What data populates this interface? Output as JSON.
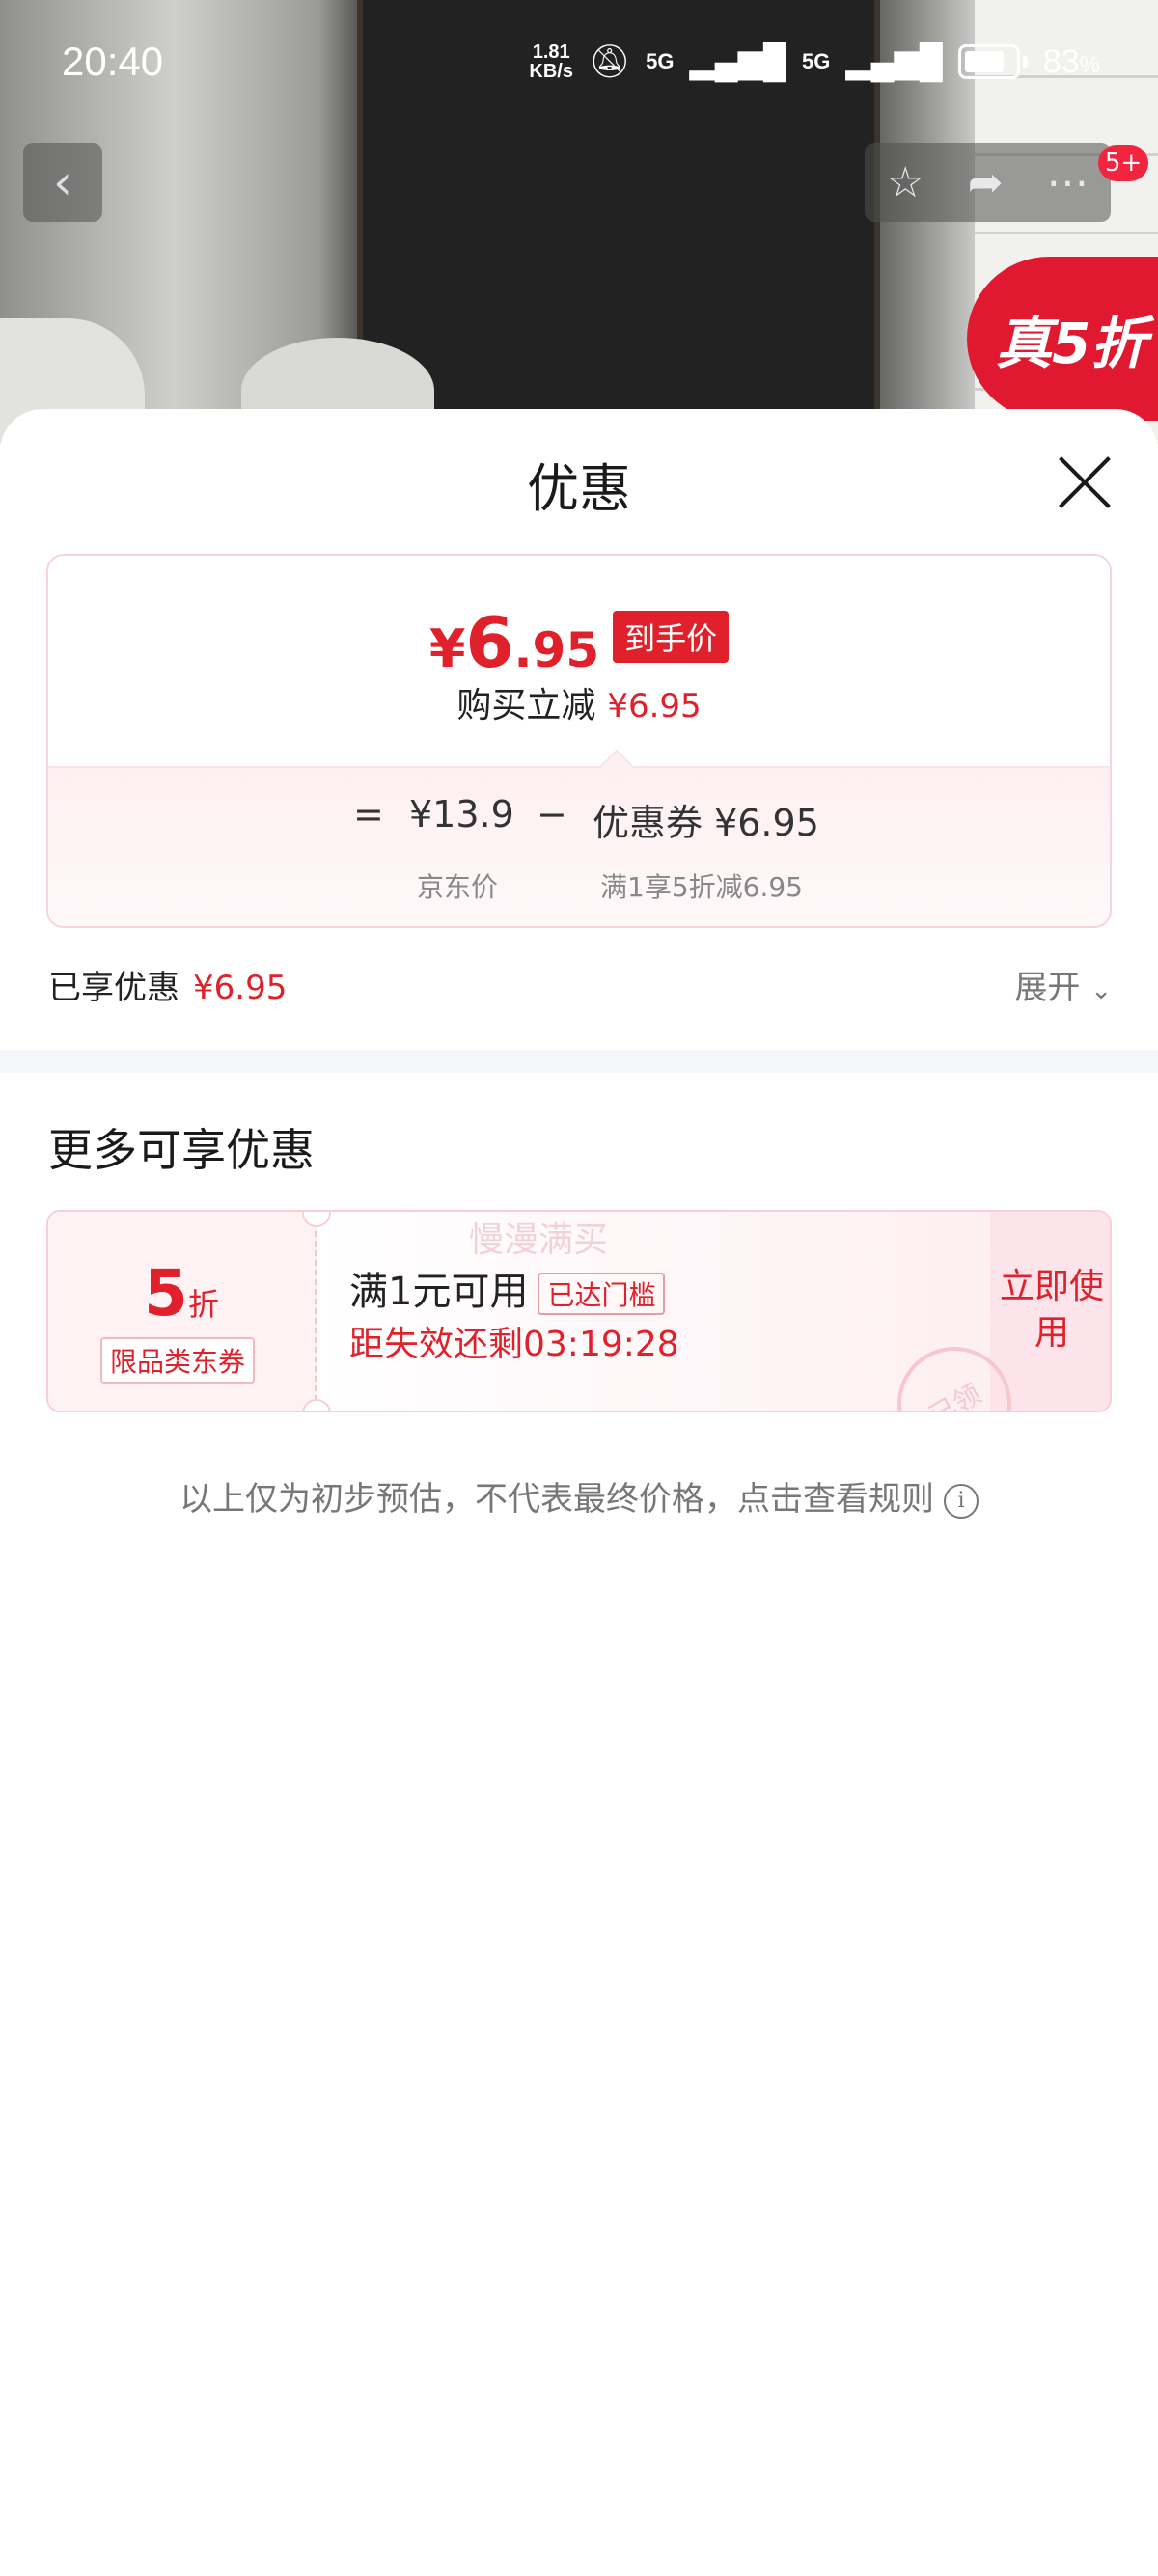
{
  "status_bar": {
    "time": "20:40",
    "net_speed": "1.81",
    "net_unit": "KB/s",
    "signal1": "5G",
    "signal2": "5G",
    "battery": "83",
    "battery_unit": "%"
  },
  "top_nav": {
    "badge": "5+",
    "promo_badge": "真5折"
  },
  "sheet": {
    "title": "优惠",
    "price": {
      "symbol": "¥",
      "int": "6",
      "dec": ".95",
      "tag": "到手价",
      "sub_label": "购买立减",
      "sub_value": "¥6.95"
    },
    "breakdown": {
      "eq": "=",
      "jd_price": "¥13.9",
      "minus": "−",
      "coupon_text": "优惠券 ¥6.95",
      "jd_price_label": "京东价",
      "coupon_label": "满1享5折减6.95"
    },
    "enjoyed": {
      "label": "已享优惠",
      "value": "¥6.95",
      "expand": "展开"
    },
    "more": {
      "title": "更多可享优惠",
      "coupon": {
        "discount_num": "5",
        "discount_unit": "折",
        "limit": "限品类东券",
        "condition": "满1元可用",
        "threshold_tag": "已达门槛",
        "countdown": "距失效还剩03:19:28",
        "watermark": "慢漫满买",
        "use_button": "立即使用",
        "stamp": "已领"
      }
    },
    "footnote": "以上仅为初步预估，不代表最终价格，点击查看规则"
  },
  "colors": {
    "accent_red": "#e0202b",
    "card_border": "#f9d3d9"
  }
}
